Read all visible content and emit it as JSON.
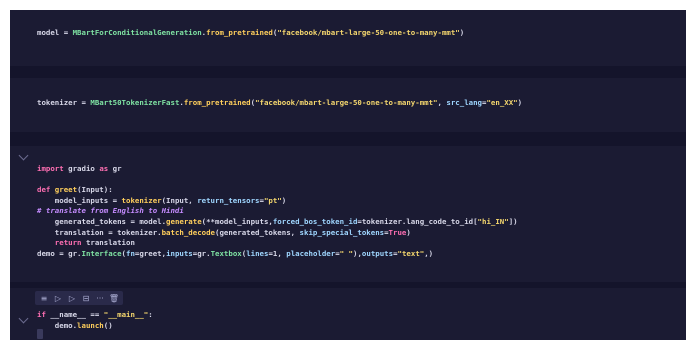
{
  "cells": {
    "model": {
      "var": "model",
      "op": " = ",
      "cls": "MBartForConditionalGeneration",
      "dot": ".",
      "method": "from_pretrained",
      "lp": "(",
      "arg": "\"facebook/mbart-large-50-one-to-many-mmt\"",
      "rp": ")"
    },
    "tokenizer": {
      "var": "tokenizer",
      "op": " = ",
      "cls": "MBart50TokenizerFast",
      "dot": ".",
      "method": "from_pretrained",
      "lp": "(",
      "arg": "\"facebook/mbart-large-50-one-to-many-mmt\"",
      "sep": ", ",
      "kw": "src_lang",
      "eq": "=",
      "val": "\"en_XX\"",
      "rp": ")"
    },
    "greet": {
      "l1_import": "import",
      "l1_mod": " gradio ",
      "l1_as": "as",
      "l1_alias": " gr",
      "l2_def": "def",
      "l2_name": " greet",
      "l2_rest": "(Input):",
      "l3_a": "    model_inputs = ",
      "l3_fn": "tokenizer",
      "l3_b": "(Input, ",
      "l3_kw": "return_tensors",
      "l3_eq": "=",
      "l3_str": "\"pt\"",
      "l3_c": ")",
      "l4_comment": "# translate from English to Hindi",
      "l5_a": "    generated_tokens = model.",
      "l5_fn": "generate",
      "l5_b": "(**model_inputs,",
      "l5_kw": "forced_bos_token_id",
      "l5_c": "=tokenizer.lang_code_to_id[",
      "l5_str": "\"hi_IN\"",
      "l5_d": "])",
      "l6_a": "    translation = tokenizer.",
      "l6_fn": "batch_decode",
      "l6_b": "(generated_tokens, ",
      "l6_kw": "skip_special_tokens",
      "l6_eq": "=",
      "l6_val": "True",
      "l6_c": ")",
      "l7_ret": "    return",
      "l7_rest": " translation",
      "l8_a": "demo = gr.",
      "l8_cls": "Interface",
      "l8_b": "(",
      "l8_kw1": "fn",
      "l8_c": "=greet,",
      "l8_kw2": "inputs",
      "l8_d": "=gr.",
      "l8_cls2": "Textbox",
      "l8_e": "(",
      "l8_kw3": "lines",
      "l8_f": "=1, ",
      "l8_kw4": "placeholder",
      "l8_g": "=",
      "l8_str1": "\" \"",
      "l8_h": "),",
      "l8_kw5": "outputs",
      "l8_i": "=",
      "l8_str2": "\"text\"",
      "l8_j": ",)"
    },
    "main": {
      "l1_if": "if",
      "l1_a": " __name__ == ",
      "l1_str": "\"__main__\"",
      "l1_b": ":",
      "l2_a": "    demo.",
      "l2_fn": "launch",
      "l2_b": "()"
    }
  },
  "toolbar": {
    "icons": [
      "format-icon",
      "run-above-icon",
      "run-below-icon",
      "split-cell-icon",
      "more-icon",
      "delete-icon"
    ],
    "glyphs": [
      "≡",
      "▷",
      "▷",
      "⊟",
      "···",
      "🗑"
    ]
  },
  "colors": {
    "background": "#14142b",
    "cell": "#1b1b33",
    "keyword": "#ff6fb3",
    "function": "#ffcf5c",
    "string": "#f5d76e",
    "comment": "#c58cff"
  }
}
